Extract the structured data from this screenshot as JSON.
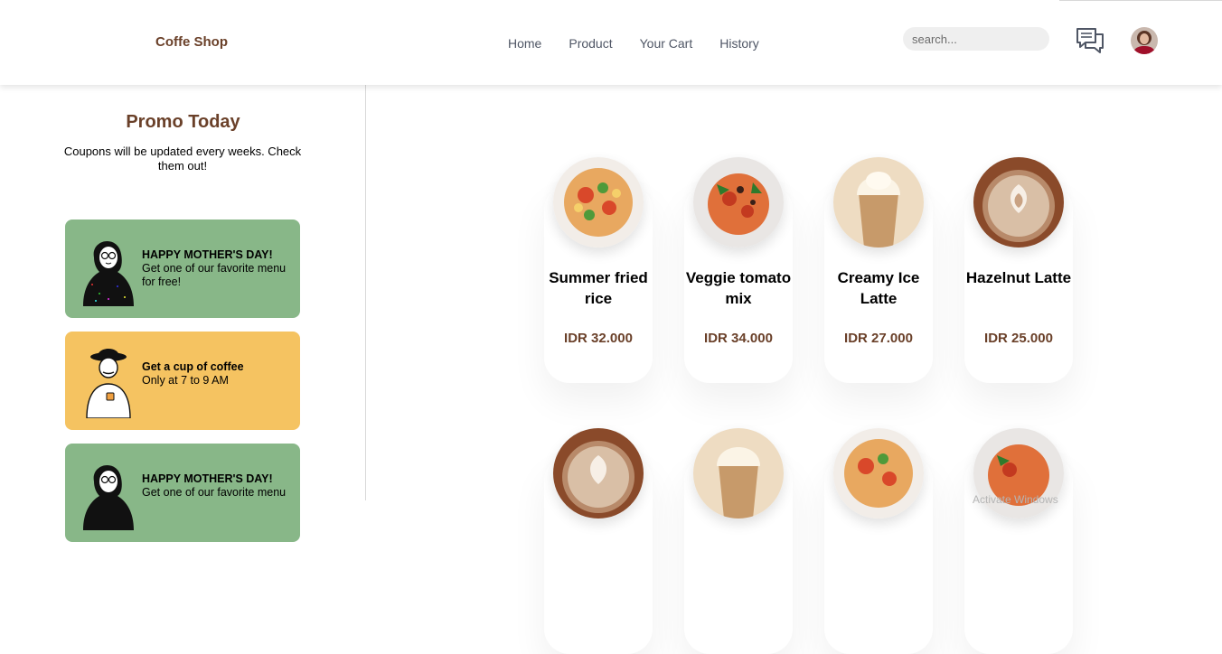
{
  "header": {
    "brand": "Coffe Shop",
    "nav": [
      "Home",
      "Product",
      "Your Cart",
      "History"
    ],
    "search_placeholder": "search...",
    "chat_icon": "chat-bubbles-icon",
    "avatar_icon": "user-avatar"
  },
  "sidebar": {
    "title": "Promo Today",
    "description": "Coupons will be updated every weeks. Check them out!",
    "coupons": [
      {
        "title": "HAPPY MOTHER'S DAY!",
        "text": "Get one of our favorite menu for free!",
        "color": "#88b788"
      },
      {
        "title": "Get a cup of coffee",
        "text": "Only at 7 to 9 AM",
        "color": "#f5c361"
      },
      {
        "title": "HAPPY MOTHER'S DAY!",
        "text": "Get one of our favorite menu",
        "color": "#88b788"
      }
    ]
  },
  "products": [
    {
      "name": "Summer fried rice",
      "price": "IDR 32.000"
    },
    {
      "name": "Veggie tomato mix",
      "price": "IDR 34.000"
    },
    {
      "name": "Creamy Ice Latte",
      "price": "IDR 27.000"
    },
    {
      "name": "Hazelnut Latte",
      "price": "IDR 25.000"
    }
  ],
  "watermark": "Activate Windows"
}
